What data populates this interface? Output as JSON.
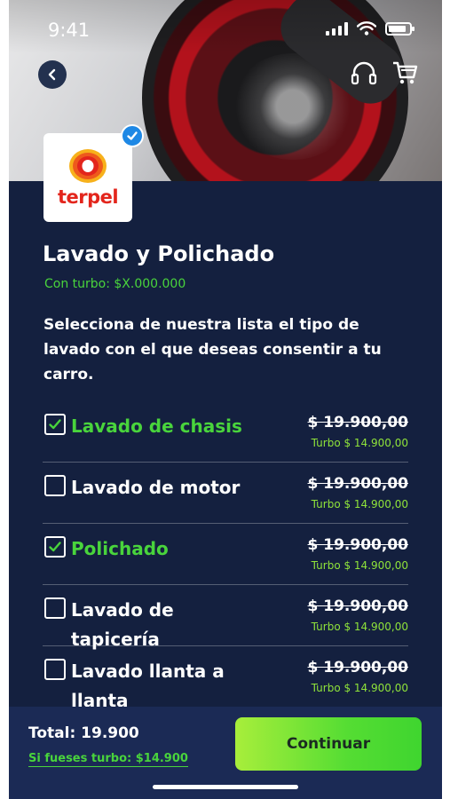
{
  "status_bar": {
    "time": "9:41"
  },
  "header": {
    "back_icon": "chevron-left-icon",
    "support_icon": "headset-icon",
    "cart_icon": "cart-icon"
  },
  "brand": {
    "logo_text": "terpel",
    "verified_icon": "check-badge-icon"
  },
  "service": {
    "title": "Lavado y Polichado",
    "turbo_price": "Con turbo: $X.000.000",
    "description": "Selecciona de nuestra lista el tipo de lavado con el que deseas consentir a tu carro."
  },
  "options": [
    {
      "label": "Lavado de chasis",
      "checked": true,
      "price": "$ 19.900,00",
      "turbo": "Turbo $ 14.900,00"
    },
    {
      "label": "Lavado de motor",
      "checked": false,
      "price": "$ 19.900,00",
      "turbo": "Turbo $ 14.900,00"
    },
    {
      "label": "Polichado",
      "checked": true,
      "price": "$ 19.900,00",
      "turbo": "Turbo $ 14.900,00"
    },
    {
      "label": "Lavado de tapicería",
      "checked": false,
      "price": "$ 19.900,00",
      "turbo": "Turbo $ 14.900,00"
    },
    {
      "label": "Lavado llanta a llanta",
      "checked": false,
      "price": "$ 19.900,00",
      "turbo": "Turbo $ 14.900,00"
    }
  ],
  "footer": {
    "total": "Total: 19.900",
    "turbo_link": "Si fueses turbo: $14.900",
    "continue_label": "Continuar"
  },
  "colors": {
    "background": "#14203f",
    "accent_green": "#49d43c",
    "turbo_green": "#8fe33a",
    "footer_bg": "#1b2a55",
    "brand_red": "#e3251c"
  }
}
